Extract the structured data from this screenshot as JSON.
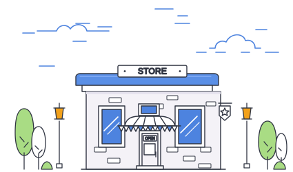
{
  "store": {
    "sign_label": "STORE",
    "open_label": "OPEN"
  },
  "colors": {
    "outline": "#2f3441",
    "accent_blue": "#5a8fe6",
    "sky_blue": "#4d83df",
    "light_blue": "#9bbcff",
    "tree_green": "#a9dc84",
    "lamp_orange": "#f2a11b",
    "wall": "#f4f2f7"
  }
}
